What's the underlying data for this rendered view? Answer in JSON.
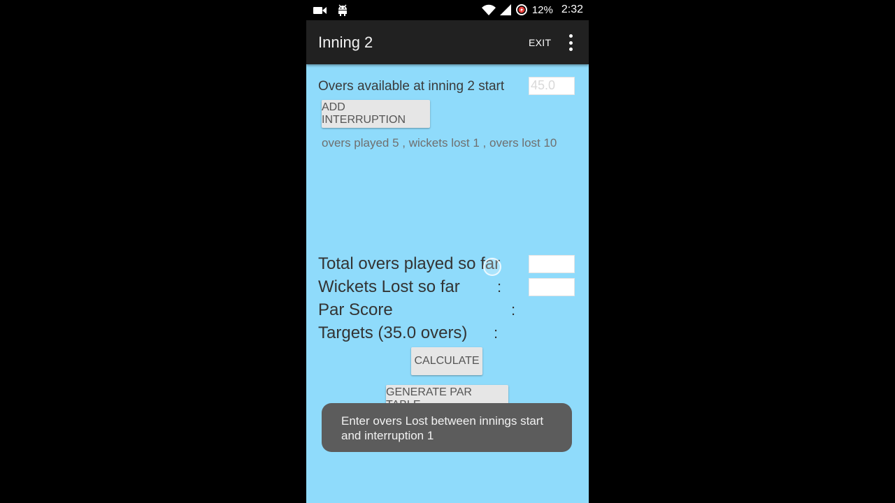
{
  "status_bar": {
    "battery_percent": "12%",
    "time": "2:32",
    "icons": [
      "video-camera-icon",
      "android-debug-icon",
      "wifi-icon",
      "signal-icon",
      "battery-saver-icon"
    ]
  },
  "app_bar": {
    "title": "Inning 2",
    "exit_label": "EXIT",
    "menu_icon": "overflow-menu-icon"
  },
  "main": {
    "overs_available_label": "Overs available at inning 2 start",
    "overs_available_value": "45.0",
    "add_interruption_label": "ADD INTERRUPTION",
    "interruption_summary": "overs played 5 , wickets lost 1 , overs lost 10",
    "total_overs_label": "Total overs played so far",
    "total_overs_value": "",
    "wickets_lost_label": "Wickets Lost so far",
    "wickets_lost_value": "",
    "par_score_label": "Par Score",
    "targets_label": "Targets (35.0 overs)",
    "colon": ":",
    "calculate_label": "CALCULATE",
    "generate_par_table_label": "GENERATE PAR TABLE"
  },
  "toast": {
    "message": "Enter overs Lost between innings start and interruption 1"
  },
  "colors": {
    "background": "#8FDBFB",
    "app_bar": "#212121",
    "toast": "#5C5C5C"
  }
}
